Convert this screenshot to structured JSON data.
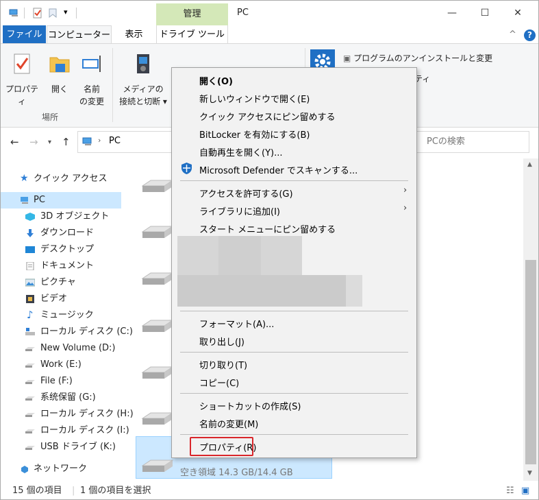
{
  "titlebar": {
    "manage_tab": "管理",
    "title": "PC",
    "minimize": "—",
    "maximize": "☐",
    "close": "✕"
  },
  "ribbon_tabs": {
    "file": "ファイル",
    "computer": "コンピューター",
    "view": "表示",
    "drive_tools": "ドライブ ツール",
    "collapse": "^",
    "help": "?"
  },
  "ribbon": {
    "properties": "プロパティ",
    "open": "開く",
    "rename_line1": "名前",
    "rename_line2": "の変更",
    "media_line1": "メディアの",
    "media_line2": "接続と切断 ▾",
    "group_location": "場所",
    "uninstall": "プログラムのアンインストールと変更",
    "properties_small": "ティ"
  },
  "address": {
    "path": "PC",
    "search_placeholder": "PCの検索"
  },
  "sidebar": {
    "quick_access": "クイック アクセス",
    "pc": "PC",
    "items": [
      "3D オブジェクト",
      "ダウンロード",
      "デスクトップ",
      "ドキュメント",
      "ピクチャ",
      "ビデオ",
      "ミュージック",
      "ローカル ディスク (C:)",
      "New Volume (D:)",
      "Work (E:)",
      "File (F:)",
      "系统保留 (G:)",
      "ローカル ディスク (H:)",
      "ローカル ディスク (I:)",
      "USB ドライブ (K:)"
    ],
    "network": "ネットワーク"
  },
  "content": {
    "free_space": "空き領域 14.3 GB/14.4 GB"
  },
  "status": {
    "item_count": "15 個の項目",
    "selected": "1 個の項目を選択"
  },
  "context_menu": {
    "open": "開く(O)",
    "new_window": "新しいウィンドウで開く(E)",
    "pin_quick": "クイック アクセスにピン留めする",
    "bitlocker": "BitLocker を有効にする(B)",
    "autoplay": "自動再生を開く(Y)...",
    "defender": "Microsoft Defender でスキャンする...",
    "give_access": "アクセスを許可する(G)",
    "add_library": "ライブラリに追加(I)",
    "pin_start": "スタート メニューにピン留めする",
    "format": "フォーマット(A)...",
    "eject": "取り出し(J)",
    "cut": "切り取り(T)",
    "copy": "コピー(C)",
    "shortcut": "ショートカットの作成(S)",
    "rename": "名前の変更(M)",
    "properties": "プロパティ(R)"
  },
  "colors": {
    "accent": "#1f6fc4",
    "selection": "#cce8ff",
    "highlight_box": "#d9262b",
    "manage_tab_bg": "#d4e8b8"
  }
}
